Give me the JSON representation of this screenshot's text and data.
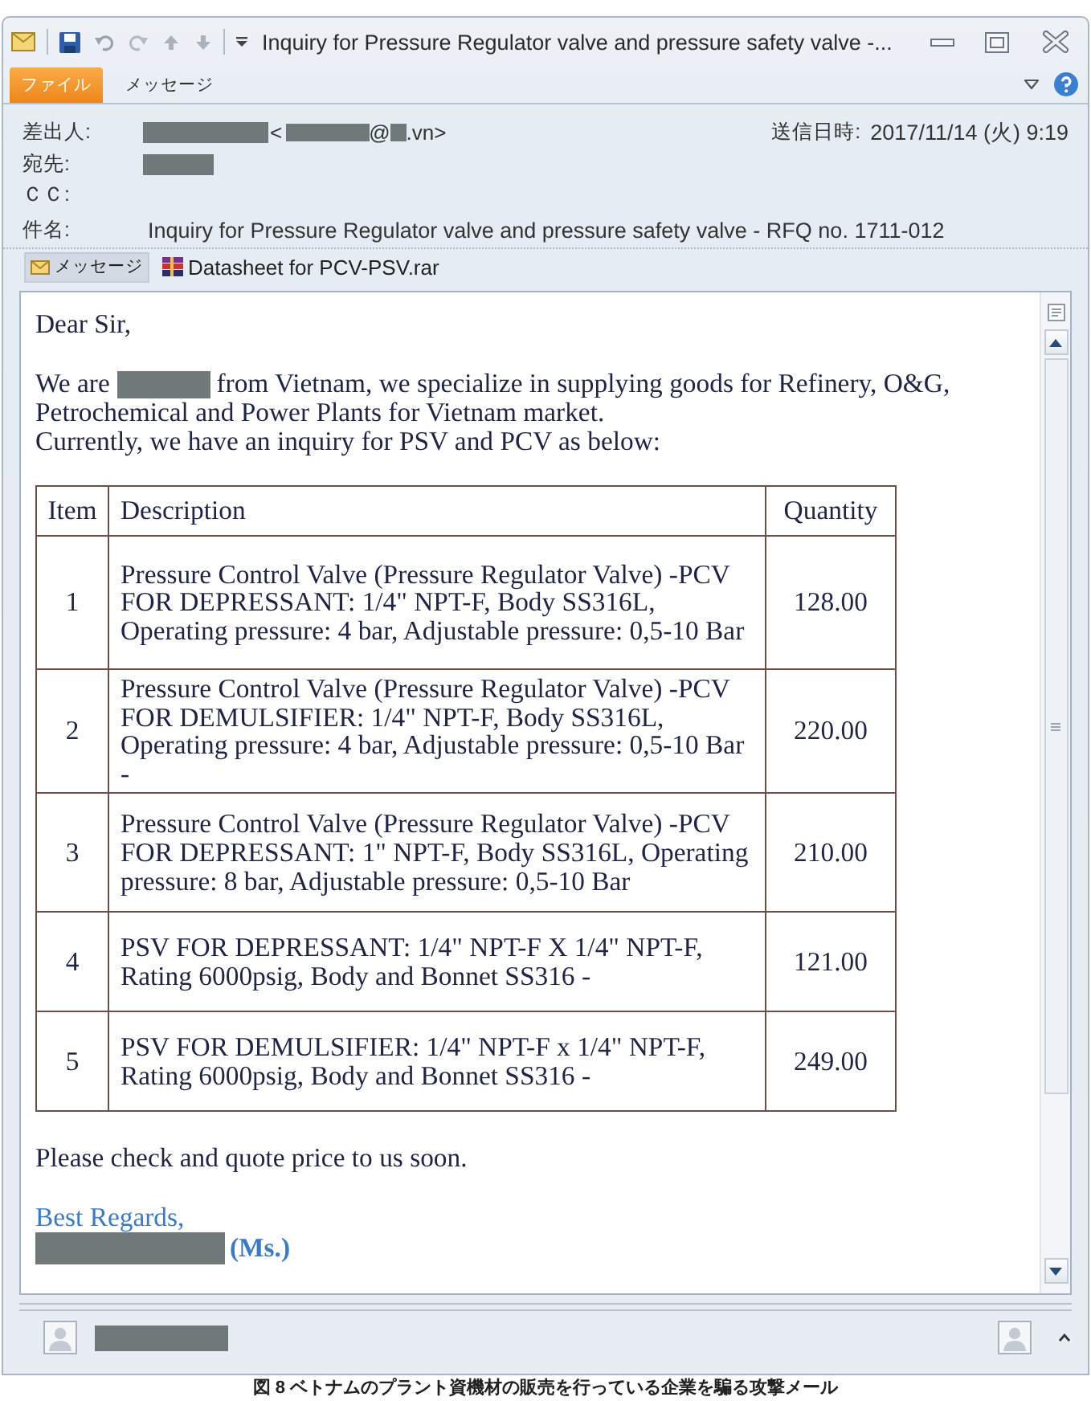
{
  "window": {
    "title": "Inquiry for Pressure Regulator valve and pressure safety valve -..."
  },
  "ribbon_tabs": [
    {
      "label": "ファイル",
      "kind": "file"
    },
    {
      "label": "メッセージ",
      "kind": "tab"
    }
  ],
  "header": {
    "from": {
      "label": "差出人:",
      "value": [
        {
          "kind": "redacted"
        },
        {
          "kind": "text",
          "text": " <"
        },
        {
          "kind": "redacted"
        },
        {
          "kind": "text",
          "text": "@"
        },
        {
          "kind": "redacted"
        },
        {
          "kind": "text",
          "text": ".vn>"
        }
      ]
    },
    "sent": {
      "label": "送信日時:",
      "value": "2017/11/14 (火) 9:19"
    },
    "to": {
      "label": "宛先:",
      "value": [
        {
          "kind": "redacted"
        }
      ]
    },
    "cc": {
      "label": "ＣＣ:"
    },
    "subject": {
      "label": "件名:",
      "value": [
        {
          "kind": "text",
          "text": "Inquiry for Pressure Regulator valve and pressure safety valve - RFQ no. 1711-012"
        }
      ]
    }
  },
  "attachments": [
    {
      "label": "メッセージ",
      "kind": "message",
      "selected": true
    },
    {
      "label": "Datasheet for PCV-PSV.rar",
      "kind": "archive",
      "selected": false
    }
  ],
  "body": {
    "greeting": "Dear Sir,",
    "intro": [
      {
        "kind": "text",
        "text": "We are "
      },
      {
        "kind": "redacted"
      },
      {
        "kind": "text",
        "text": " from Vietnam, we specialize in supplying goods for Refinery, O&G, Petrochemical and Power Plants for Vietnam market."
      }
    ],
    "lead": "Currently, we have an inquiry for PSV and PCV as below:",
    "table": {
      "columns": [
        "Item",
        "Description",
        "Quantity"
      ],
      "rows": [
        {
          "item": "1",
          "description": "Pressure Control Valve (Pressure Regulator Valve) -PCV FOR DEPRESSANT: 1/4\" NPT-F, Body SS316L, Operating pressure: 4 bar, Adjustable pressure: 0,5-10 Bar",
          "quantity": "128.00"
        },
        {
          "item": "2",
          "description": "Pressure Control Valve (Pressure Regulator Valve) -PCV FOR DEMULSIFIER: 1/4\" NPT-F, Body SS316L, Operating pressure: 4 bar, Adjustable pressure: 0,5-10 Bar -",
          "quantity": "220.00"
        },
        {
          "item": "3",
          "description": "Pressure Control Valve (Pressure Regulator Valve) -PCV FOR DEPRESSANT: 1\" NPT-F, Body SS316L, Operating pressure: 8 bar, Adjustable pressure: 0,5-10 Bar",
          "quantity": "210.00"
        },
        {
          "item": "4",
          "description": "PSV FOR DEPRESSANT: 1/4\" NPT-F X 1/4\" NPT-F, Rating 6000psig, Body and Bonnet SS316 -",
          "quantity": "121.00"
        },
        {
          "item": "5",
          "description": "PSV FOR DEMULSIFIER: 1/4\" NPT-F x 1/4\" NPT-F, Rating 6000psig, Body and Bonnet SS316 -",
          "quantity": "249.00"
        }
      ]
    },
    "closing": "Please check and quote price to us soon.",
    "regards": "Best Regards,",
    "signature": [
      {
        "kind": "redacted"
      },
      {
        "kind": "text",
        "text": "(Ms.)"
      }
    ]
  },
  "people_pane": {
    "contact": [
      {
        "kind": "redacted"
      }
    ]
  },
  "caption": "図 8 ベトナムのプラント資機材の販売を行っている企業を騙る攻撃メール"
}
